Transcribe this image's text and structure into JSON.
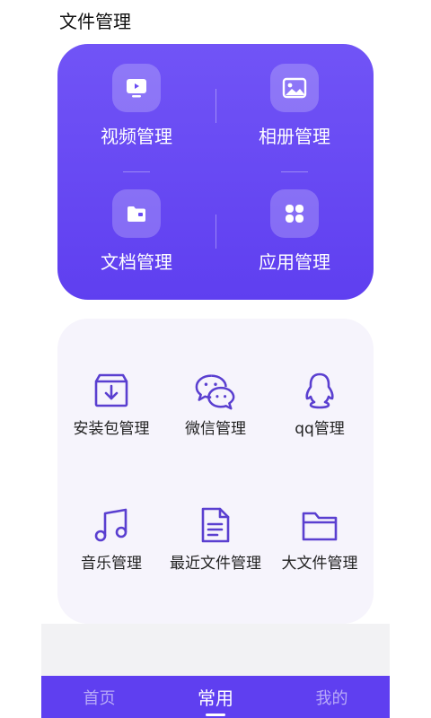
{
  "header": {
    "title": "文件管理"
  },
  "primary": {
    "items": [
      {
        "label": "视频管理",
        "icon": "video-icon"
      },
      {
        "label": "相册管理",
        "icon": "album-icon"
      },
      {
        "label": "文档管理",
        "icon": "document-folder-icon"
      },
      {
        "label": "应用管理",
        "icon": "apps-grid-icon"
      }
    ]
  },
  "secondary": {
    "items": [
      {
        "label": "安装包管理",
        "icon": "package-download-icon"
      },
      {
        "label": "微信管理",
        "icon": "wechat-icon"
      },
      {
        "label": "qq管理",
        "icon": "qq-icon"
      },
      {
        "label": "音乐管理",
        "icon": "music-note-icon"
      },
      {
        "label": "最近文件管理",
        "icon": "recent-file-icon"
      },
      {
        "label": "大文件管理",
        "icon": "folder-icon"
      }
    ]
  },
  "nav": {
    "items": [
      {
        "label": "首页",
        "active": false
      },
      {
        "label": "常用",
        "active": true
      },
      {
        "label": "我的",
        "active": false
      }
    ]
  },
  "colors": {
    "accent": "#5f3ff0",
    "card_light": "#f6f4fc",
    "icon_stroke": "#5a3fd0"
  }
}
